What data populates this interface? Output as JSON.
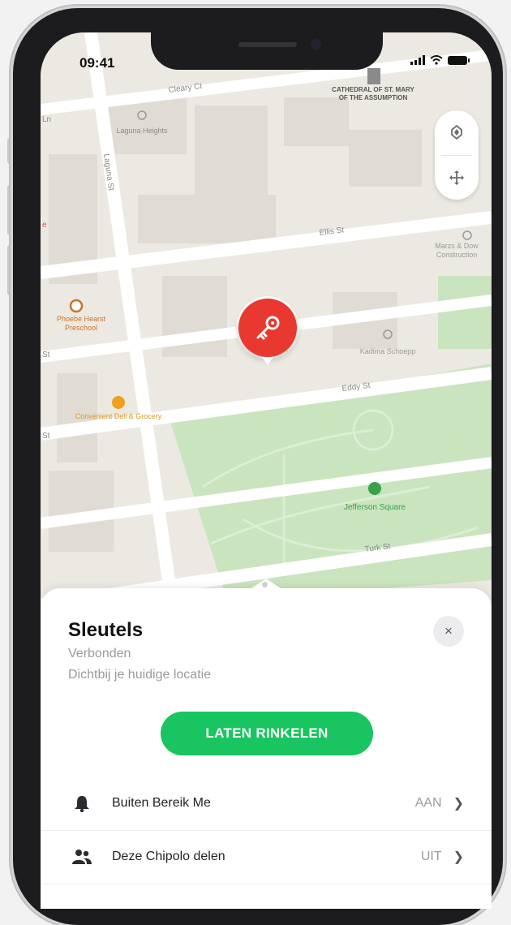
{
  "status_bar": {
    "time": "09:41"
  },
  "map": {
    "streets": [
      "Cleary Ct",
      "Laguna St",
      "Ellis St",
      "Eddy St",
      "Turk St"
    ],
    "places": [
      {
        "name": "Laguna Heights"
      },
      {
        "name": "CATHEDRAL OF ST. MARY OF THE ASSUMPTION"
      },
      {
        "name": "Marzs & Dow Construction"
      },
      {
        "name": "Phoebe Hearst Preschool"
      },
      {
        "name": "Kadima Schoepp"
      },
      {
        "name": "Convenient Deli & Grocery"
      },
      {
        "name": "Jefferson Square"
      }
    ],
    "partial_labels": [
      "Ln",
      "St",
      "St",
      "e"
    ]
  },
  "item": {
    "name": "Sleutels",
    "status": "Verbonden",
    "location": "Dichtbij je huidige locatie",
    "ring_button": "LATEN RINKELEN",
    "close_icon": "×"
  },
  "settings": [
    {
      "label": "Buiten Bereik Me",
      "value": "AAN",
      "icon": "bell-icon"
    },
    {
      "label": "Deze Chipolo delen",
      "value": "UIT",
      "icon": "people-icon"
    }
  ],
  "colors": {
    "pin": "#e8382f",
    "ring_button": "#18c560",
    "park": "#c9e4be"
  }
}
